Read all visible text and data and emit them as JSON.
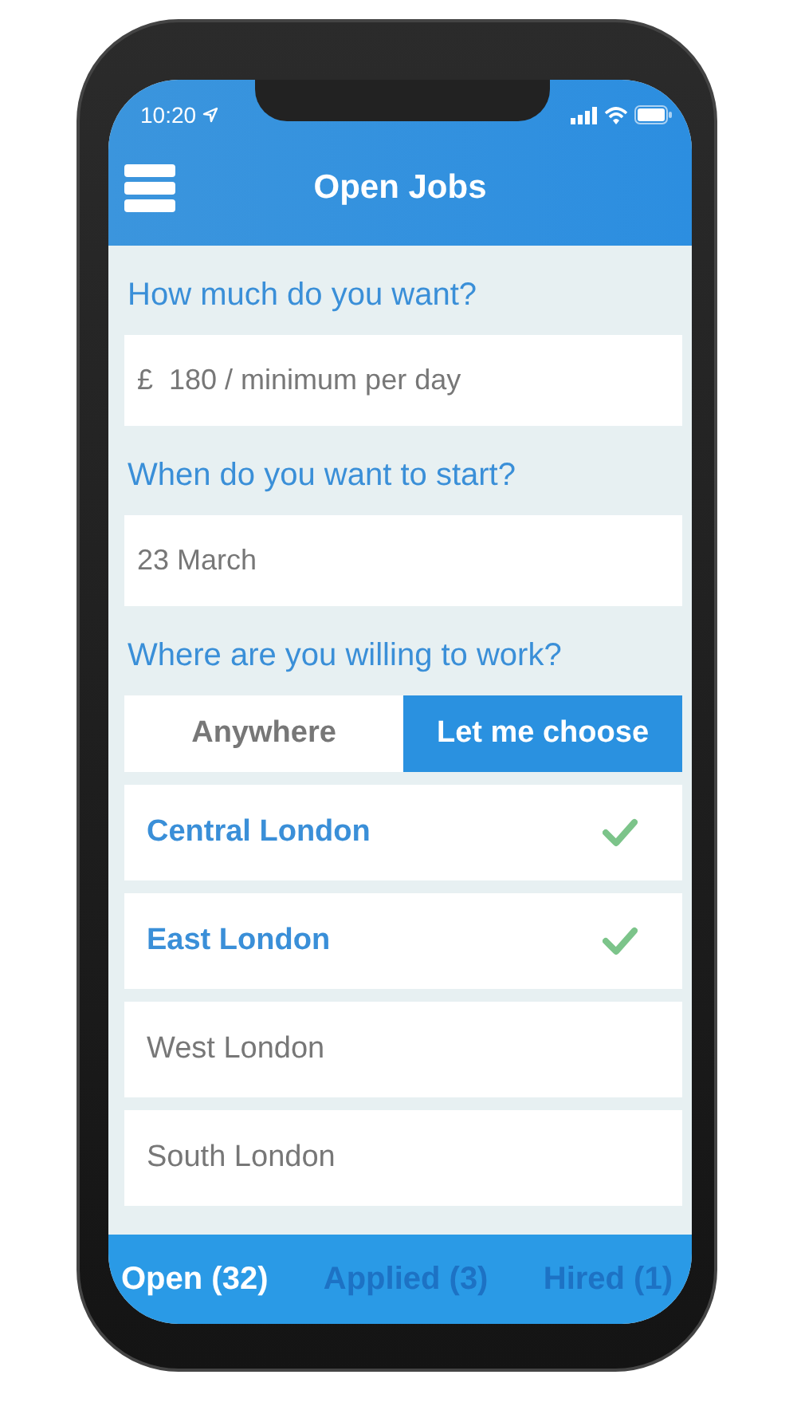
{
  "status_bar": {
    "time": "10:20"
  },
  "header": {
    "title": "Open Jobs"
  },
  "form": [
    {
      "kind": "field",
      "question": "How much do you want?",
      "prefix": "£",
      "value": "180 / minimum per day"
    },
    {
      "kind": "field",
      "question": "When do you want to start?",
      "value": "23 March"
    },
    {
      "kind": "choice",
      "question": "Where are you willing to work?",
      "options": [
        {
          "label": "Anywhere",
          "selected": false
        },
        {
          "label": "Let me choose",
          "selected": true
        }
      ],
      "locations": [
        {
          "label": "Central London",
          "checked": true
        },
        {
          "label": "East London",
          "checked": true
        },
        {
          "label": "West London",
          "checked": false
        },
        {
          "label": "South London",
          "checked": false
        }
      ]
    }
  ],
  "tabs": [
    {
      "label": "Open (32)",
      "selected": true
    },
    {
      "label": "Applied (3)",
      "selected": false
    },
    {
      "label": "Hired (1)",
      "selected": false
    }
  ]
}
